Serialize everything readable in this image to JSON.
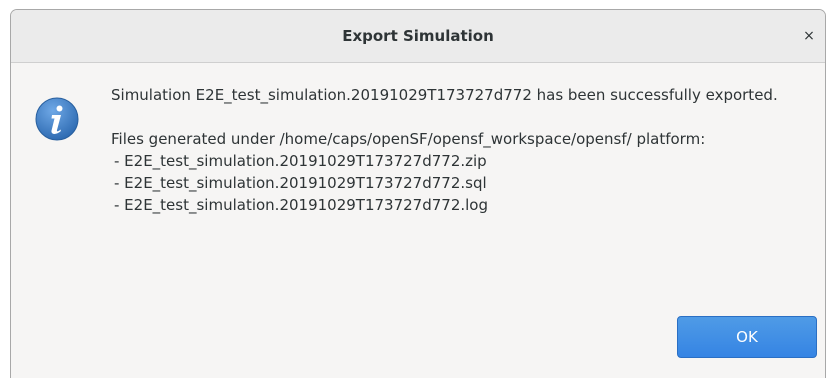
{
  "dialog": {
    "title": "Export Simulation",
    "close_glyph": "×",
    "icon": "info-icon",
    "message_line1": "Simulation E2E_test_simulation.20191029T173727d772 has been successfully exported.",
    "message_files_header": "Files generated under /home/caps/openSF/opensf_workspace/opensf/ platform:",
    "files": [
      "- E2E_test_simulation.20191029T173727d772.zip",
      "- E2E_test_simulation.20191029T173727d772.sql",
      "- E2E_test_simulation.20191029T173727d772.log"
    ],
    "ok_label": "OK"
  },
  "colors": {
    "accent": "#3584e4",
    "titlebar": "#ebebeb",
    "background": "#f6f5f4",
    "text": "#2e3436"
  }
}
